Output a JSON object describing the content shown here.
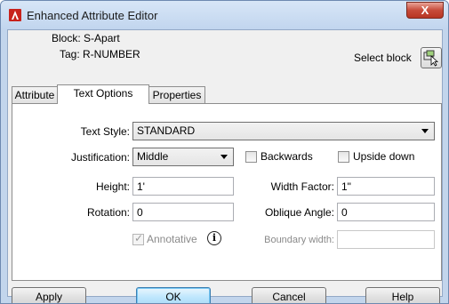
{
  "window": {
    "title": "Enhanced Attribute Editor",
    "close_label": "X"
  },
  "block_info": {
    "block_line": "Block: S-Apart",
    "tag_line": "Tag: R-NUMBER",
    "select_block_label": "Select block"
  },
  "tabs": [
    {
      "label": "Attribute",
      "active": false
    },
    {
      "label": "Text Options",
      "active": true
    },
    {
      "label": "Properties",
      "active": false
    }
  ],
  "text_options": {
    "text_style_label": "Text Style:",
    "text_style_value": "STANDARD",
    "justification_label": "Justification:",
    "justification_value": "Middle",
    "backwards_label": "Backwards",
    "backwards_checked": false,
    "upside_down_label": "Upside down",
    "upside_down_checked": false,
    "height_label": "Height:",
    "height_value": "1'",
    "width_factor_label": "Width Factor:",
    "width_factor_value": "1\"",
    "rotation_label": "Rotation:",
    "rotation_value": "0",
    "oblique_angle_label": "Oblique Angle:",
    "oblique_angle_value": "0",
    "annotative_label": "Annotative",
    "annotative_checked": true,
    "annotative_enabled": false,
    "boundary_width_label": "Boundary width:",
    "boundary_width_value": ""
  },
  "buttons": {
    "apply": "Apply",
    "ok": "OK",
    "cancel": "Cancel",
    "help": "Help"
  },
  "colors": {
    "window_frame": "#c2d5ec",
    "close_button": "#c74b3a",
    "default_button": "#bee6fd"
  },
  "icons": {
    "app": "autocad-logo-icon",
    "select_block": "select-objects-icon",
    "annotative_info": "info-icon"
  }
}
